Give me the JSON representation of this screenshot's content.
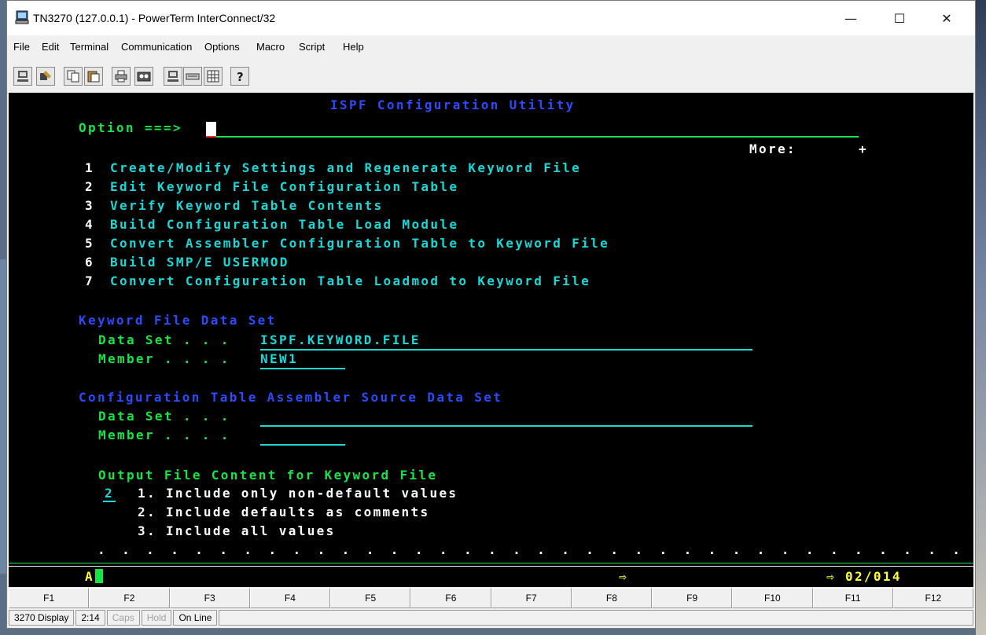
{
  "window": {
    "title": "TN3270 (127.0.0.1) - PowerTerm InterConnect/32",
    "minimize": "—",
    "maximize": "☐",
    "close": "✕"
  },
  "menu": [
    "File",
    "Edit",
    "Terminal",
    "Communication",
    "Options",
    "Macro",
    "Script",
    "Help"
  ],
  "toolbar_icons": [
    "connect-icon",
    "disconnect-icon",
    "copy-icon",
    "paste-icon",
    "print-icon",
    "record-icon",
    "terminal-icon",
    "keyboard-icon",
    "grid-icon",
    "help-icon"
  ],
  "screen": {
    "header": "ISPF Configuration Utility",
    "option_label": "Option ===>",
    "more_label": "More:",
    "more_sign": "+",
    "menu_items": [
      {
        "num": "1",
        "label": "Create/Modify Settings and Regenerate Keyword File"
      },
      {
        "num": "2",
        "label": "Edit Keyword File Configuration Table"
      },
      {
        "num": "3",
        "label": "Verify Keyword Table Contents"
      },
      {
        "num": "4",
        "label": "Build Configuration Table Load Module"
      },
      {
        "num": "5",
        "label": "Convert Assembler Configuration Table to Keyword File"
      },
      {
        "num": "6",
        "label": "Build SMP/E USERMOD"
      },
      {
        "num": "7",
        "label": "Convert Configuration Table Loadmod to Keyword File"
      }
    ],
    "keyword_section": "Keyword File Data Set",
    "keyword_dataset_label": "Data Set . . .",
    "keyword_dataset_value": "ISPF.KEYWORD.FILE",
    "keyword_member_label": "Member . . . .",
    "keyword_member_value": "NEW1",
    "asm_section": "Configuration Table Assembler Source Data Set",
    "asm_dataset_label": "Data Set . . .",
    "asm_member_label": "Member . . . .",
    "output_title": "Output File Content for Keyword File",
    "output_selection": "2",
    "output_options": [
      "1. Include only non-default values",
      "2. Include defaults as comments",
      "3. Include all values"
    ],
    "dots": ". . . . . . . . . . . . . . . . . . . . . . . . . . . . . . . . . . . . . ."
  },
  "status_line": {
    "left": "A",
    "arrow": "⇨",
    "position": "⇨ 02/014"
  },
  "fkeys": [
    "F1",
    "F2",
    "F3",
    "F4",
    "F5",
    "F6",
    "F7",
    "F8",
    "F9",
    "F10",
    "F11",
    "F12"
  ],
  "statusbar": {
    "display": "3270 Display",
    "cursor": "2:14",
    "caps": "Caps",
    "hold": "Hold",
    "online": "On Line"
  }
}
